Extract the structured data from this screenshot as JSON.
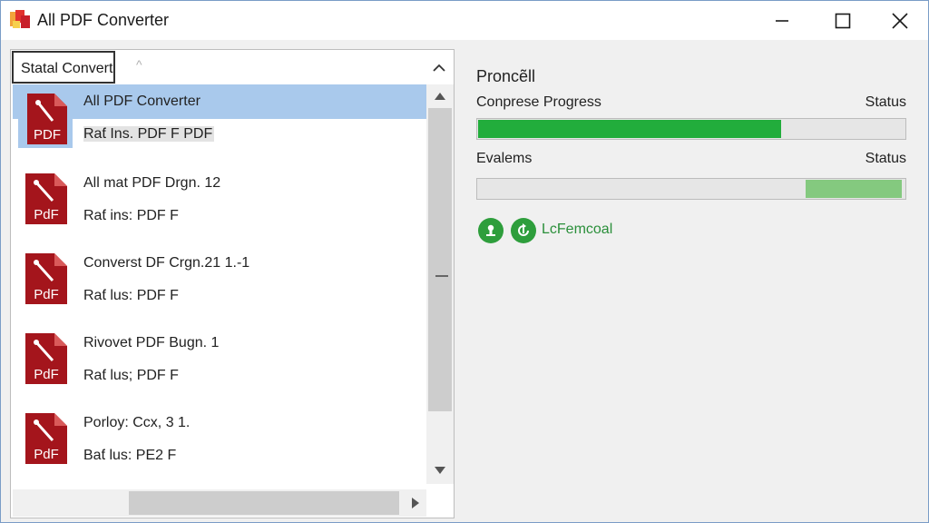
{
  "window": {
    "title": "All PDF Converter",
    "icon": "app-logo-icon",
    "controls": [
      "minimize-icon",
      "maximize-icon",
      "close-icon"
    ]
  },
  "left": {
    "combo_value": "Statal Convert",
    "combo_caret": "^",
    "items": [
      {
        "title": "All PDF Converter",
        "subtitle": "Raƭ Ins. PDF F PDF",
        "thumb_label": "PDF",
        "selected": true
      },
      {
        "title": "All mat PDF Drgn. 12",
        "subtitle": "Raƭ ins: PDF F",
        "thumb_label": "PdF",
        "selected": false
      },
      {
        "title": "Converst DF Crgn.21 1.-1",
        "subtitle": "Raƭ lus: PDF F",
        "thumb_label": "PdF",
        "selected": false
      },
      {
        "title": "Rivovet PDF Bugn. 1",
        "subtitle": "Raƭ lus; PDF F",
        "thumb_label": "PdF",
        "selected": false
      },
      {
        "title": "Porloy: Ccx, 3 1.",
        "subtitle": "Baƭ lus: PE2 F",
        "thumb_label": "PdF",
        "selected": false
      }
    ]
  },
  "right": {
    "heading": "Proncẽll",
    "progress1": {
      "label": "Conprese Progress",
      "status": "Status",
      "fraction": 0.71,
      "color": "#22ad3c"
    },
    "progress2": {
      "label": "Evalems",
      "status": "Status",
      "fill_start": 0.77,
      "fill_end": 0.995,
      "color": "#84c97f"
    },
    "actions": [
      {
        "icon": "download-icon"
      },
      {
        "icon": "refresh-icon"
      }
    ],
    "action_label": "LcFemcoal"
  }
}
